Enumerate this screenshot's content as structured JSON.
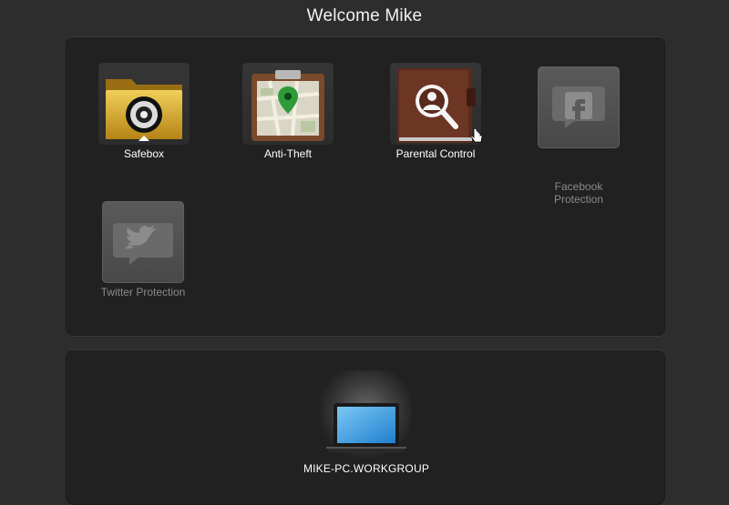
{
  "header": {
    "title": "Welcome Mike"
  },
  "apps": [
    {
      "label": "Safebox",
      "icon": "folder-lock-icon",
      "enabled": true
    },
    {
      "label": "Anti-Theft",
      "icon": "map-clipboard-icon",
      "enabled": true
    },
    {
      "label": "Parental Control",
      "icon": "parental-book-icon",
      "enabled": true
    },
    {
      "label": "Facebook\nProtection",
      "icon": "facebook-icon",
      "enabled": false
    },
    {
      "label": "Twitter Protection",
      "icon": "twitter-icon",
      "enabled": false
    }
  ],
  "devices": [
    {
      "label": "MIKE-PC.WORKGROUP",
      "icon": "laptop-icon"
    }
  ],
  "colors": {
    "background": "#2d2d2d",
    "panel": "#212121",
    "gold": "#d4a52a",
    "map_pin": "#2e9a3a",
    "screen_blue": "#2f9be0",
    "book_brown": "#5a2a1c",
    "disabled_label": "#8a8a8a"
  }
}
